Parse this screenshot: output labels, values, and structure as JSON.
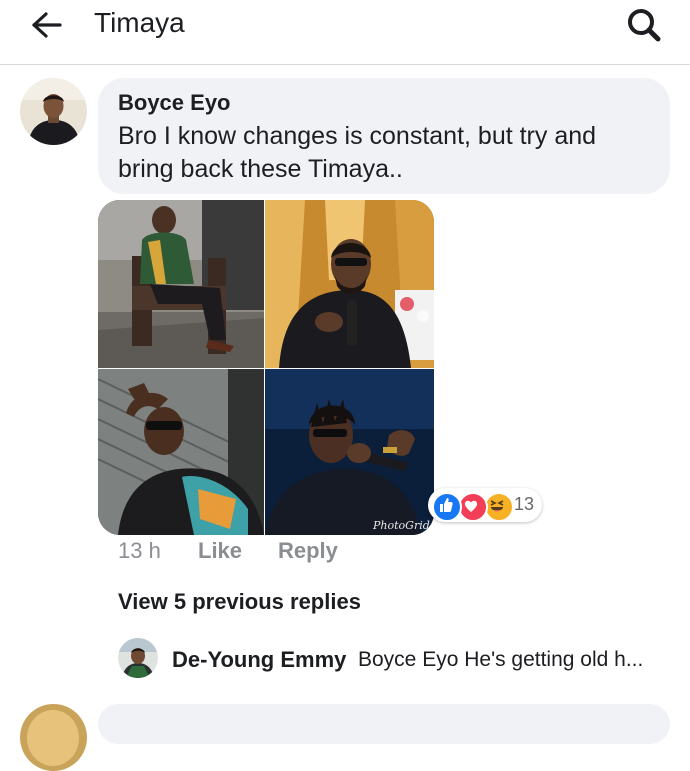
{
  "header": {
    "title": "Timaya",
    "back_icon": "arrow-left-icon",
    "search_icon": "search-icon"
  },
  "comment": {
    "author": "Boyce Eyo",
    "text": "Bro I know changes is constant, but try and bring back these Timaya..",
    "photo_watermark": "PhotoGrid",
    "reactions": {
      "icons": [
        "like-icon",
        "love-icon",
        "haha-icon"
      ],
      "count": "13"
    },
    "time": "13 h",
    "like_label": "Like",
    "reply_label": "Reply"
  },
  "replies": {
    "view_previous_label": "View 5 previous replies",
    "latest": {
      "author": "De-Young Emmy",
      "text": "Boyce Eyo He's getting old  h..."
    }
  },
  "colors": {
    "bubble": "#f0f2f5",
    "secondary_text": "#8a8d91",
    "like_blue": "#1877f2",
    "love_red": "#f33e58",
    "haha_yellow": "#f7b125"
  }
}
